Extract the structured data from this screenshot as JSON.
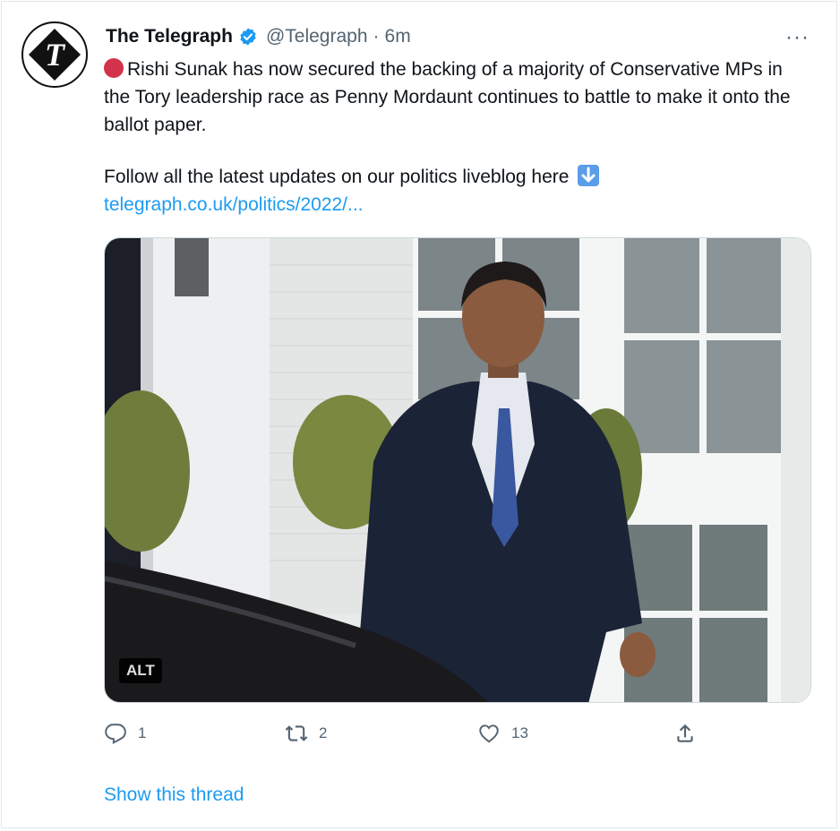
{
  "tweet": {
    "author_name": "The Telegraph",
    "handle": "@Telegraph",
    "separator": "·",
    "time": "6m",
    "more_label": "···",
    "text_line1": "Rishi Sunak has now secured the backing of a majority of Conservative MPs in the Tory leadership race as Penny Mordaunt continues to battle to make it onto the ballot paper.",
    "text_line2": "Follow all the latest updates on our politics liveblog here",
    "link_text": "telegraph.co.uk/politics/2022/...",
    "media_alt_label": "ALT",
    "show_thread": "Show this thread"
  },
  "actions": {
    "replies": "1",
    "retweets": "2",
    "likes": "13"
  },
  "icons": {
    "avatar": "telegraph-logo-icon",
    "verified": "verified-badge-icon",
    "more": "more-options-icon",
    "reply": "reply-icon",
    "retweet": "retweet-icon",
    "like": "heart-icon",
    "share": "share-icon",
    "red_circle": "red-circle-emoji-icon",
    "down_arrow": "down-arrow-emoji-icon"
  },
  "colors": {
    "link": "#1d9bf0",
    "secondary_text": "#536471",
    "red_circle": "#d2334a",
    "verified": "#1d9bf0"
  }
}
